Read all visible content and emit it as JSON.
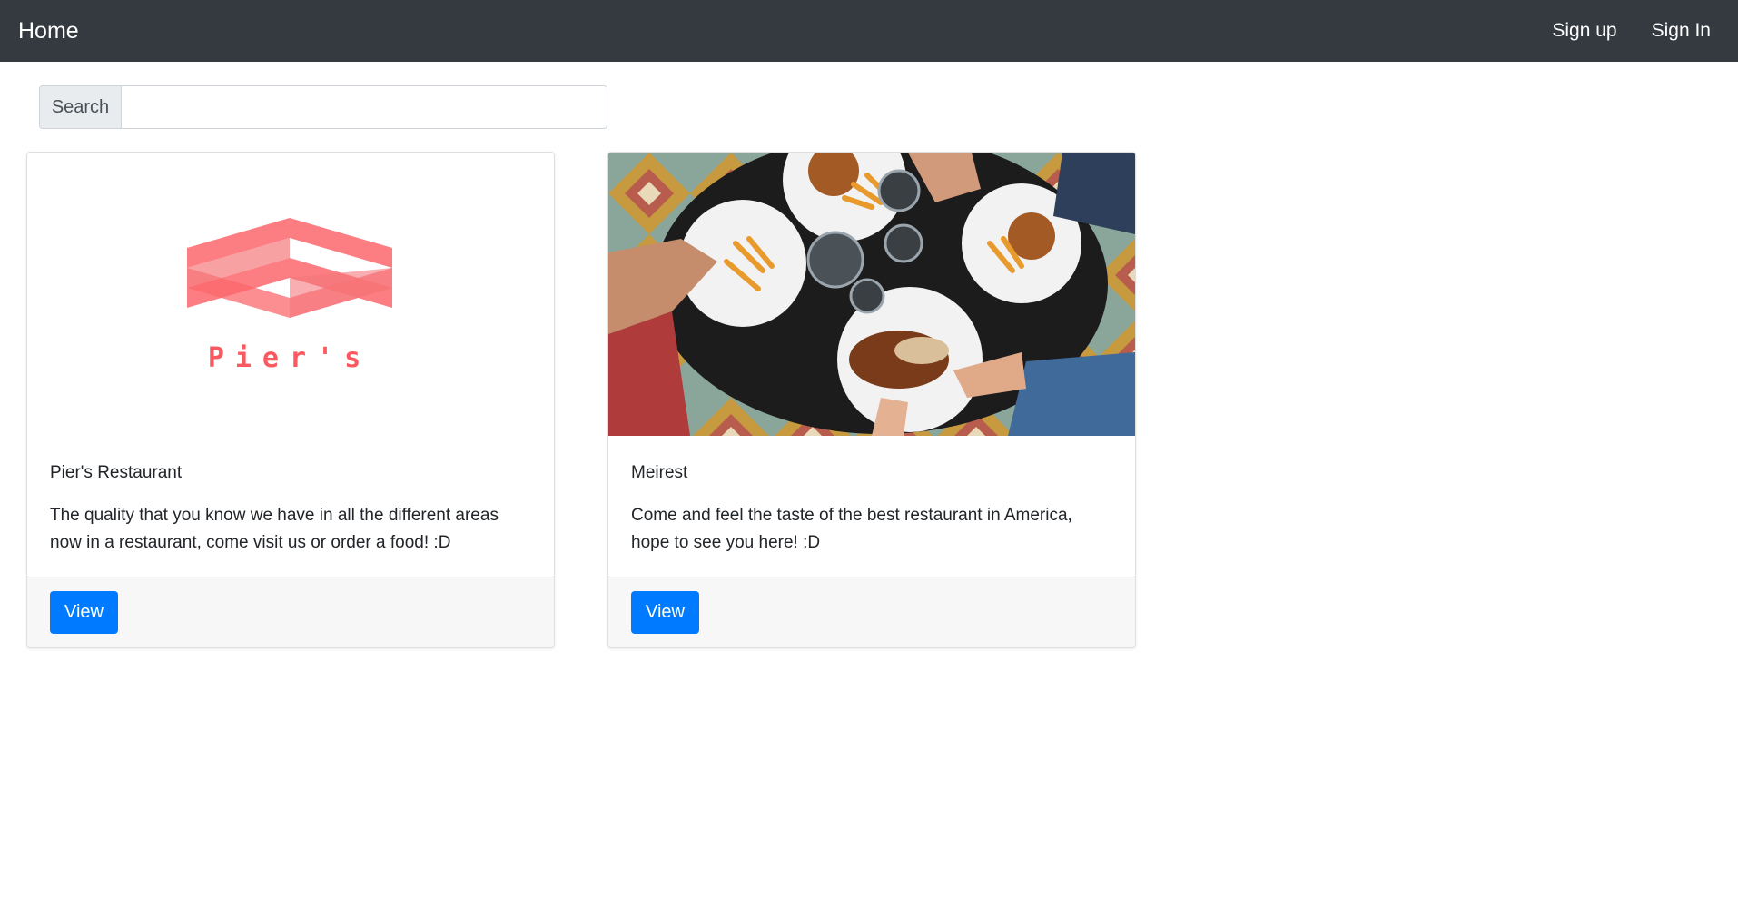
{
  "navbar": {
    "brand": "Home",
    "links": [
      "Sign up",
      "Sign In"
    ]
  },
  "search": {
    "label": "Search",
    "value": "",
    "placeholder": ""
  },
  "cards": [
    {
      "logo_text": "Pier's",
      "title": "Pier's Restaurant",
      "description": "The quality that you know we have in all the different areas now in a restaurant, come visit us or order a food! :D",
      "button_label": "View"
    },
    {
      "title": "Meirest",
      "description": "Come and feel the taste of the best restaurant in America, hope to see you here! :D",
      "button_label": "View"
    }
  ],
  "colors": {
    "navbar_bg": "#343a40",
    "primary": "#007bff",
    "logo": "#fa5a5f"
  }
}
